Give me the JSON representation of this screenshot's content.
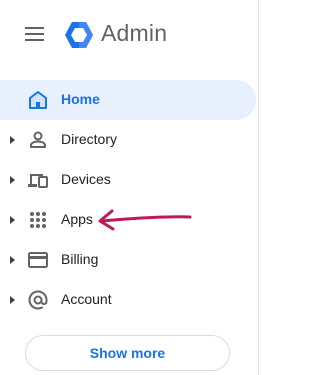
{
  "header": {
    "title": "Admin",
    "menu_icon": "hamburger-menu-icon",
    "logo_icon": "admin-hexagon-logo",
    "brand_color": "#1a73e8"
  },
  "nav": {
    "items": [
      {
        "label": "Home",
        "icon": "home-icon",
        "active": true,
        "expandable": false
      },
      {
        "label": "Directory",
        "icon": "person-icon",
        "active": false,
        "expandable": true
      },
      {
        "label": "Devices",
        "icon": "devices-icon",
        "active": false,
        "expandable": true
      },
      {
        "label": "Apps",
        "icon": "apps-grid-icon",
        "active": false,
        "expandable": true
      },
      {
        "label": "Billing",
        "icon": "credit-card-icon",
        "active": false,
        "expandable": true
      },
      {
        "label": "Account",
        "icon": "at-sign-icon",
        "active": false,
        "expandable": true
      }
    ]
  },
  "annotation": {
    "arrow_icon": "pointer-arrow-icon",
    "arrow_color": "#c2185b"
  },
  "footer": {
    "show_more_label": "Show more"
  },
  "colors": {
    "active_bg": "#e8f0fe",
    "active_text": "#1a73e8",
    "text": "#202124",
    "icon": "#5f6368"
  }
}
